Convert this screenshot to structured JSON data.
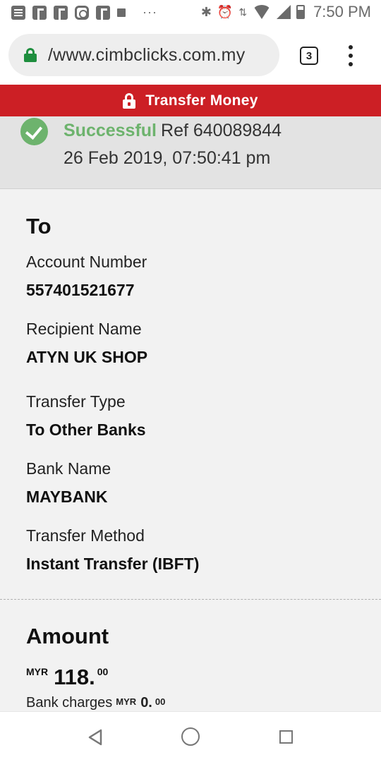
{
  "status_bar": {
    "time": "7:50 PM",
    "overflow": "···",
    "icons": [
      "message-icon",
      "facebook-icon",
      "facebook-icon",
      "instagram-icon",
      "facebook-icon",
      "square-icon",
      "bluetooth-icon",
      "alarm-icon",
      "data-arrows-icon",
      "wifi-icon",
      "signal-icon",
      "battery-icon"
    ]
  },
  "browser": {
    "url": "/www.cimbclicks.com.my",
    "tab_count": "3"
  },
  "header": {
    "title": "Transfer Money"
  },
  "status": {
    "result": "Successful",
    "reference": "Ref 640089844",
    "datetime": "26 Feb 2019, 07:50:41 pm",
    "success_color": "#6db36d"
  },
  "to_section": {
    "heading": "To",
    "fields": [
      {
        "label": "Account Number",
        "value": "557401521677"
      },
      {
        "label": "Recipient Name",
        "value": "ATYN UK SHOP"
      },
      {
        "label": "Transfer Type",
        "value": "To Other Banks"
      },
      {
        "label": "Bank Name",
        "value": "MAYBANK"
      },
      {
        "label": "Transfer Method",
        "value": "Instant Transfer (IBFT)"
      }
    ]
  },
  "amount_section": {
    "heading": "Amount",
    "currency": "MYR",
    "amount_int": "118.",
    "amount_dec": "00",
    "bank_charges_label": "Bank charges",
    "charges_currency": "MYR",
    "charges_int": "0.",
    "charges_dec": "00"
  },
  "colors": {
    "brand_red": "#cc1f25",
    "lock_green": "#1e8e3e"
  }
}
